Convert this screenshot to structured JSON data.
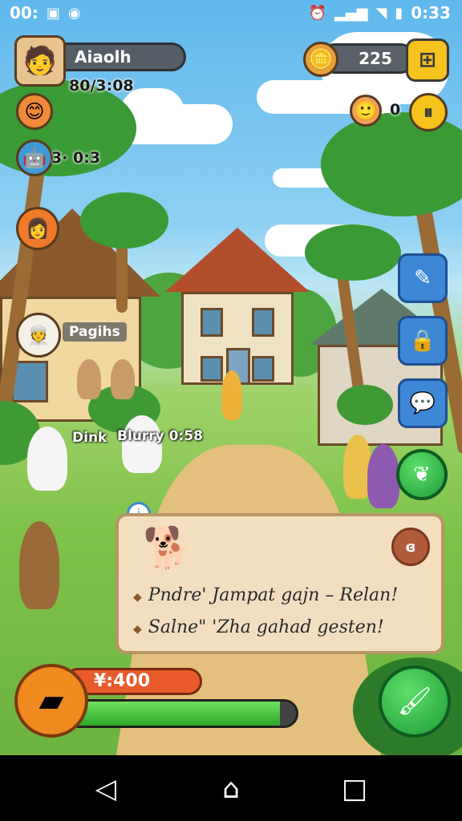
{
  "status_bar": {
    "left_text": "00:",
    "time": "0:33"
  },
  "player": {
    "name": "Aiaolh",
    "stat1": "80/3:08",
    "stat2": "3· 0:3"
  },
  "currency": {
    "coins": "225",
    "secondary": "0"
  },
  "npc_labels": {
    "label_house": "Pagihs",
    "label_left": "Dink",
    "label_mid": "Blurry 0:58"
  },
  "dialog": {
    "line1": "Pndre' Jampat gajn – Relan!",
    "line2": "Salne\" 'Zha gahad gesten!",
    "close_label": "ɞ"
  },
  "bottom": {
    "money": "¥:400",
    "progress_fraction": 0.93
  },
  "colors": {
    "accent_orange": "#f08a1e",
    "accent_green": "#2fa82a",
    "side_blue": "#3e86d6"
  },
  "icons": {
    "tool": "wood-plank-icon",
    "action_top": "leaf-icon",
    "action_bottom": "brush-icon",
    "side1": "pencil-icon",
    "side2": "lock-icon",
    "side3": "chat-icon"
  }
}
